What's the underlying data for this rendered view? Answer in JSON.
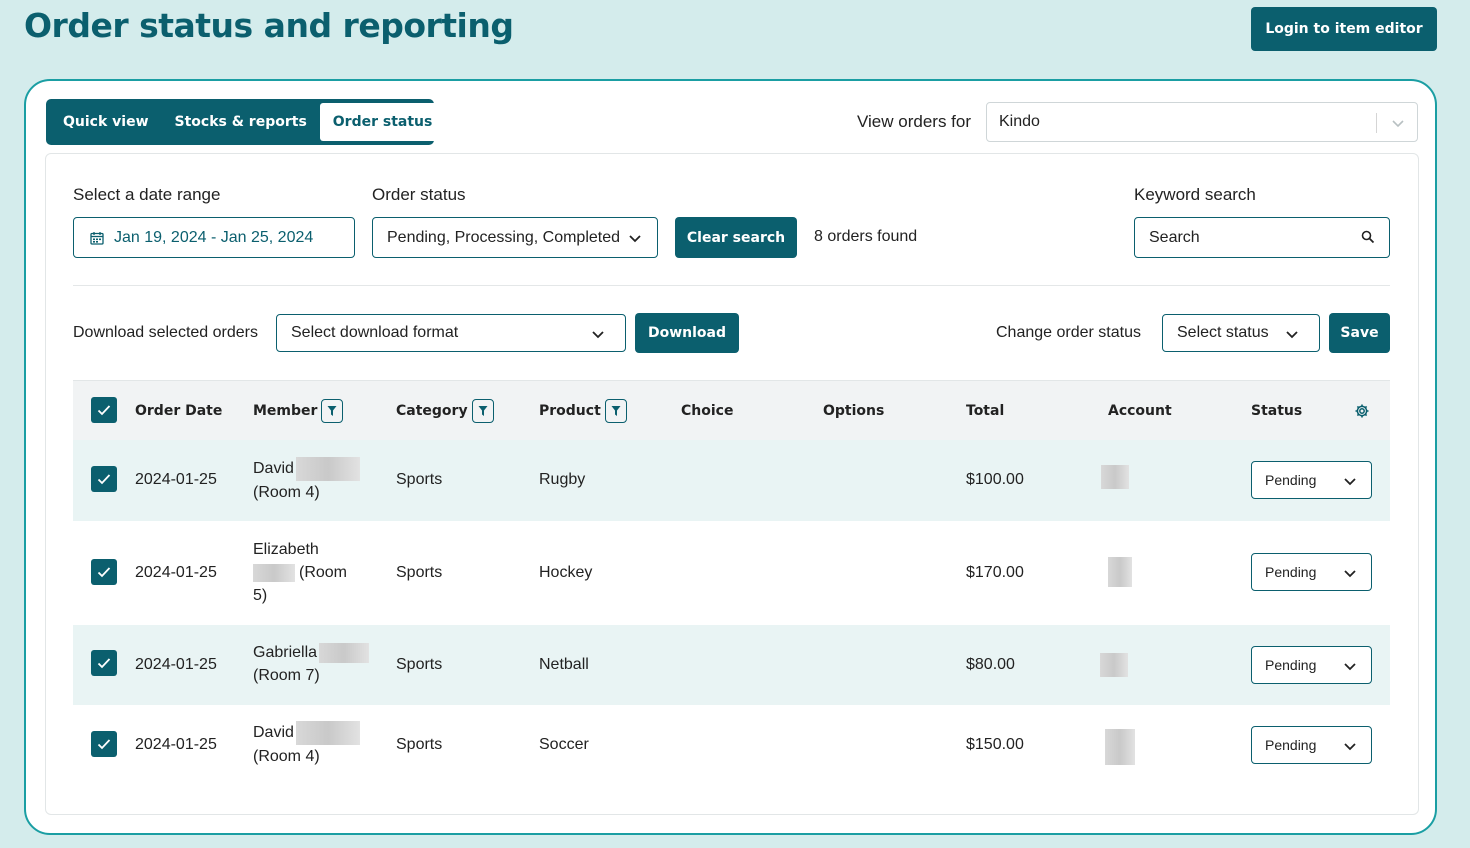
{
  "page": {
    "title": "Order status and reporting",
    "login_button": "Login to item editor"
  },
  "tabs": [
    {
      "label": "Quick view"
    },
    {
      "label": "Stocks & reports"
    },
    {
      "label": "Order status"
    }
  ],
  "view_orders": {
    "label": "View orders for",
    "value": "Kindo"
  },
  "filters": {
    "date_label": "Select a date range",
    "date_value": "Jan 19, 2024 - Jan 25, 2024",
    "status_label": "Order status",
    "status_value": "Pending, Processing, Completed",
    "clear_button": "Clear search",
    "orders_found": "8 orders found",
    "keyword_label": "Keyword search",
    "search_placeholder": "Search"
  },
  "actions": {
    "download_label": "Download selected orders",
    "download_format_placeholder": "Select download format",
    "download_button": "Download",
    "change_status_label": "Change order status",
    "select_status_placeholder": "Select status",
    "save_button": "Save"
  },
  "table": {
    "columns": [
      "Order Date",
      "Member",
      "Category",
      "Product",
      "Choice",
      "Options",
      "Total",
      "Account",
      "Status"
    ],
    "rows": [
      {
        "date": "2024-01-25",
        "member_line1": "David",
        "member_line2": "(Room 4)",
        "category": "Sports",
        "product": "Rugby",
        "total": "$100.00",
        "status": "Pending"
      },
      {
        "date": "2024-01-25",
        "member_line1": "Elizabeth",
        "member_line2": "(Room",
        "member_line3": "5)",
        "category": "Sports",
        "product": "Hockey",
        "total": "$170.00",
        "status": "Pending"
      },
      {
        "date": "2024-01-25",
        "member_line1": "Gabriella",
        "member_line2": "(Room 7)",
        "category": "Sports",
        "product": "Netball",
        "total": "$80.00",
        "status": "Pending"
      },
      {
        "date": "2024-01-25",
        "member_line1": "David",
        "member_line2": "(Room 4)",
        "category": "Sports",
        "product": "Soccer",
        "total": "$150.00",
        "status": "Pending"
      }
    ]
  },
  "icons": {
    "calendar": "calendar-icon",
    "chevron": "chevron-down-icon",
    "search": "search-icon",
    "filter": "filter-icon",
    "check": "check-icon",
    "settings": "gear-icon"
  },
  "colors": {
    "brand": "#0b5f6e",
    "accent_border": "#1a9ea3",
    "page_bg": "#d4ecec",
    "row_tint": "#e9f4f4"
  }
}
